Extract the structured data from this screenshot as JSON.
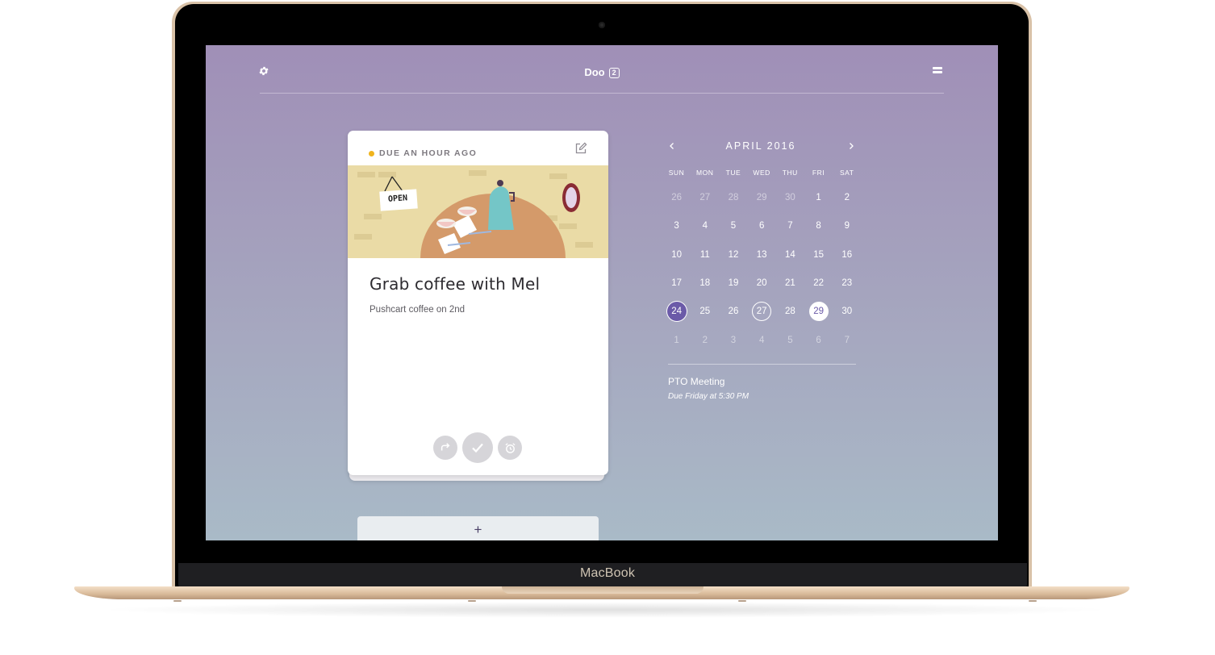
{
  "device": {
    "brand": "MacBook"
  },
  "header": {
    "app_name": "Doo",
    "badge_count": "2",
    "settings_icon": "gear-icon",
    "menu_icon": "menu-icon"
  },
  "card": {
    "status": "DUE AN HOUR AGO",
    "status_color": "#f0b41e",
    "sign_text": "OPEN",
    "title": "Grab coffee with Mel",
    "subtitle": "Pushcart coffee on 2nd",
    "actions": [
      "repeat-icon",
      "check-icon",
      "alarm-clock-icon"
    ]
  },
  "add_button": {
    "label": "+"
  },
  "calendar": {
    "month_label": "APRIL 2016",
    "prev_icon": "chevron-left-icon",
    "next_icon": "chevron-right-icon",
    "weekdays": [
      "SUN",
      "MON",
      "TUE",
      "WED",
      "THU",
      "FRI",
      "SAT"
    ],
    "weeks": [
      [
        {
          "d": "26",
          "t": "oth"
        },
        {
          "d": "27",
          "t": "oth"
        },
        {
          "d": "28",
          "t": "oth"
        },
        {
          "d": "29",
          "t": "oth"
        },
        {
          "d": "30",
          "t": "oth"
        },
        {
          "d": "1",
          "t": "cur"
        },
        {
          "d": "2",
          "t": "cur"
        }
      ],
      [
        {
          "d": "3",
          "t": "cur"
        },
        {
          "d": "4",
          "t": "cur"
        },
        {
          "d": "5",
          "t": "cur"
        },
        {
          "d": "6",
          "t": "cur"
        },
        {
          "d": "7",
          "t": "cur"
        },
        {
          "d": "8",
          "t": "cur"
        },
        {
          "d": "9",
          "t": "cur"
        }
      ],
      [
        {
          "d": "10",
          "t": "cur"
        },
        {
          "d": "11",
          "t": "cur"
        },
        {
          "d": "12",
          "t": "cur"
        },
        {
          "d": "13",
          "t": "cur"
        },
        {
          "d": "14",
          "t": "cur"
        },
        {
          "d": "15",
          "t": "cur"
        },
        {
          "d": "16",
          "t": "cur"
        }
      ],
      [
        {
          "d": "17",
          "t": "cur"
        },
        {
          "d": "18",
          "t": "cur"
        },
        {
          "d": "19",
          "t": "cur"
        },
        {
          "d": "20",
          "t": "cur"
        },
        {
          "d": "21",
          "t": "cur"
        },
        {
          "d": "22",
          "t": "cur"
        },
        {
          "d": "23",
          "t": "cur"
        }
      ],
      [
        {
          "d": "24",
          "t": "sel"
        },
        {
          "d": "25",
          "t": "cur"
        },
        {
          "d": "26",
          "t": "cur"
        },
        {
          "d": "27",
          "t": "ring"
        },
        {
          "d": "28",
          "t": "cur"
        },
        {
          "d": "29",
          "t": "today"
        },
        {
          "d": "30",
          "t": "cur"
        }
      ],
      [
        {
          "d": "1",
          "t": "oth"
        },
        {
          "d": "2",
          "t": "oth"
        },
        {
          "d": "3",
          "t": "oth"
        },
        {
          "d": "4",
          "t": "oth"
        },
        {
          "d": "5",
          "t": "oth"
        },
        {
          "d": "6",
          "t": "oth"
        },
        {
          "d": "7",
          "t": "oth"
        }
      ]
    ],
    "selected_color": "#6b5aa8"
  },
  "event": {
    "title": "PTO Meeting",
    "due": "Due Friday at 5:30 PM"
  }
}
